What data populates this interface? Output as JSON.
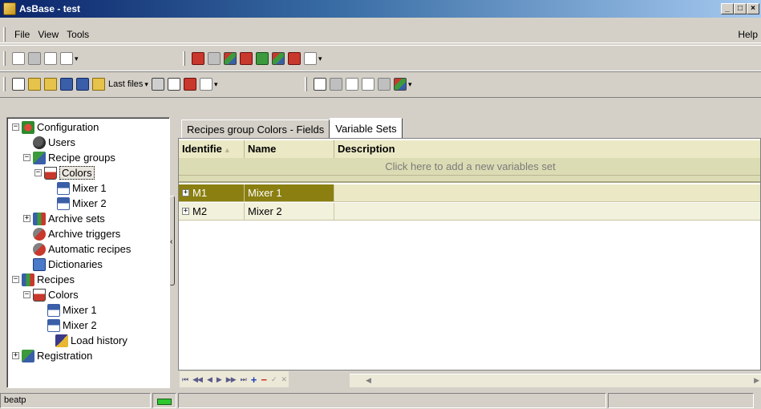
{
  "window": {
    "title": "AsBase - test",
    "buttons": [
      "_",
      "□",
      "×"
    ]
  },
  "menu": {
    "items": [
      "File",
      "View",
      "Tools"
    ],
    "help": "Help"
  },
  "toolbar": {
    "last_files_label": "Last files",
    "dropdown_glyph": "▾"
  },
  "tree": {
    "items": [
      {
        "label": "Configuration",
        "icon": "config-icon",
        "expander": "−"
      },
      {
        "label": "Users",
        "icon": "users-icon",
        "expander": ""
      },
      {
        "label": "Recipe groups",
        "icon": "recipe-groups-icon",
        "expander": "−"
      },
      {
        "label": "Colors",
        "icon": "flask-icon",
        "expander": "−",
        "selected": true
      },
      {
        "label": "Mixer 1",
        "icon": "xy-table-icon",
        "expander": ""
      },
      {
        "label": "Mixer 2",
        "icon": "xy-table-icon",
        "expander": ""
      },
      {
        "label": "Archive sets",
        "icon": "archive-sets-icon",
        "expander": "+"
      },
      {
        "label": "Archive triggers",
        "icon": "trigger-icon",
        "expander": ""
      },
      {
        "label": "Automatic recipes",
        "icon": "trigger-icon",
        "expander": ""
      },
      {
        "label": "Dictionaries",
        "icon": "dictionary-icon",
        "expander": ""
      },
      {
        "label": "Recipes",
        "icon": "archive-sets-icon",
        "expander": "−"
      },
      {
        "label": "Colors",
        "icon": "flask-icon",
        "expander": "−"
      },
      {
        "label": "Mixer 1",
        "icon": "xy-table-icon",
        "expander": ""
      },
      {
        "label": "Mixer 2",
        "icon": "xy-table-icon",
        "expander": ""
      },
      {
        "label": "Load history",
        "icon": "history-icon",
        "expander": ""
      },
      {
        "label": "Registration",
        "icon": "registration-icon",
        "expander": "+"
      }
    ]
  },
  "tabs": [
    {
      "label": "Recipes group Colors - Fields",
      "active": false
    },
    {
      "label": "Variable Sets",
      "active": true
    }
  ],
  "grid": {
    "columns": [
      "Identifie",
      "Name",
      "Description"
    ],
    "add_row_text": "Click here to add a new variables set",
    "rows": [
      {
        "id": "M1",
        "name": "Mixer 1",
        "description": "",
        "selected": true
      },
      {
        "id": "M2",
        "name": "Mixer 2",
        "description": "",
        "selected": false
      }
    ]
  },
  "navigator": {
    "buttons": [
      "⏮",
      "◀◀",
      "◀",
      "▶",
      "▶▶",
      "⏭",
      "+",
      "−",
      "✓",
      "✕"
    ]
  },
  "status": {
    "user": "beatp"
  },
  "colors": {
    "selected_row": "#8a7f10",
    "grid_header": "#ebe9c5",
    "add_row": "#dcdcb4",
    "status_led": "#2ec82e"
  }
}
